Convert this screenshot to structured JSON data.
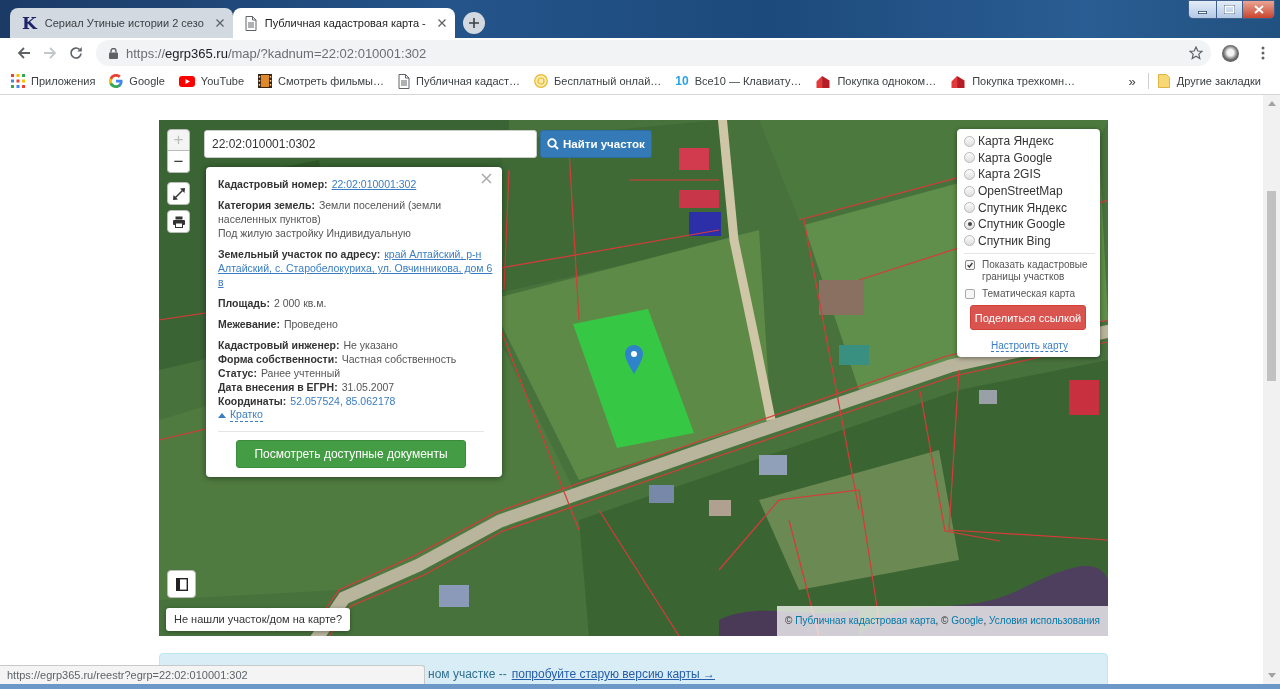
{
  "browser": {
    "tabs": [
      {
        "title": "Сериал Утиные истории 2 сезо",
        "kind": "letter",
        "favicon_text": "K",
        "selected": false
      },
      {
        "title": "Публичная кадастровая карта -",
        "kind": "page",
        "selected": true
      }
    ],
    "navigation": {
      "back_disabled": false,
      "forward_disabled": true
    },
    "url": [
      {
        "text": "https://",
        "emphasis": false
      },
      {
        "text": "egrp365.ru",
        "emphasis": true
      },
      {
        "text": "/map/?kadnum=22:02:010001:302",
        "emphasis": false
      }
    ],
    "bookmarks": [
      {
        "title": "Приложения",
        "kind": "apps"
      },
      {
        "title": "Google",
        "kind": "google"
      },
      {
        "title": "YouTube",
        "kind": "video"
      },
      {
        "title": "Смотреть фильмы…",
        "kind": "film"
      },
      {
        "title": "Публичная кадаст…",
        "kind": "page"
      },
      {
        "title": "Бесплатный онлай…",
        "kind": "ring"
      },
      {
        "title": "Все10 — Клавиату…",
        "kind": "number",
        "icon_text": "10"
      },
      {
        "title": "Покупка одноком…",
        "kind": "house"
      },
      {
        "title": "Покупка трехкомн…",
        "kind": "house"
      }
    ],
    "bookmarks_overflow": "»",
    "other_bookmarks": "Другие закладки"
  },
  "map": {
    "zoom": [
      {
        "label": "+",
        "disabled": true
      },
      {
        "label": "−",
        "disabled": false
      }
    ],
    "search": {
      "value": "22:02:010001:0302",
      "button": "Найти участок"
    },
    "popup": {
      "sections": [
        [
          {
            "label": "Кадастровый номер:",
            "value": "22:02:010001:302",
            "kind": "link"
          }
        ],
        [
          {
            "label": "Категория земель:",
            "value": "Земли поселений (земли населенных пунктов)",
            "kind": "text"
          },
          {
            "value": "Под жилую застройку Индивидуальную",
            "kind": "text"
          }
        ],
        [
          {
            "label": "Земельный участок по адресу:",
            "lines": [
              "край Алтайский, р-н",
              "Алтайский, с. Старобелокуриха, ул. Овчинникова, дом 6",
              "в"
            ],
            "kind": "link"
          }
        ],
        [
          {
            "label": "Площадь:",
            "value": "2 000 кв.м.",
            "kind": "text"
          }
        ],
        [
          {
            "label": "Межевание:",
            "value": "Проведено",
            "kind": "text"
          }
        ],
        [
          {
            "label": "Кадастровый инженер:",
            "value": "Не указано",
            "kind": "text"
          },
          {
            "label": "Форма собственности:",
            "value": "Частная собственность",
            "kind": "text"
          },
          {
            "label": "Статус:",
            "value": "Ранее учтенный",
            "kind": "text"
          },
          {
            "label": "Дата внесения в ЕГРН:",
            "value": "31.05.2007",
            "kind": "text"
          },
          {
            "label": "Координаты:",
            "value": "52.057524, 85.062178",
            "kind": "accent"
          }
        ]
      ],
      "collapse_link": "Кратко",
      "button": "Посмотреть доступные документы"
    },
    "layers": {
      "options": [
        {
          "label": "Карта Яндекс",
          "selected": false
        },
        {
          "label": "Карта Google",
          "selected": false
        },
        {
          "label": "Карта 2GIS",
          "selected": false
        },
        {
          "label": "OpenStreetMap",
          "selected": false
        },
        {
          "label": "Спутник Яндекс",
          "selected": false
        },
        {
          "label": "Спутник Google",
          "selected": true
        },
        {
          "label": "Спутник Bing",
          "selected": false
        }
      ],
      "toggles": [
        {
          "label": "Показать кадастровые границы участков",
          "checked": true
        },
        {
          "label": "Тематическая карта",
          "checked": false
        }
      ],
      "share_button": "Поделиться ссылкой",
      "settings_link": "Настроить карту"
    },
    "help_prompt": "Не нашли участок/дом на карте?",
    "attribution": [
      {
        "text": "© ",
        "kind": "text"
      },
      {
        "text": "Публичная кадастровая карта",
        "kind": "link"
      },
      {
        "text": ", © ",
        "kind": "text"
      },
      {
        "text": "Google",
        "kind": "link"
      },
      {
        "text": ", ",
        "kind": "text"
      },
      {
        "text": "Условия использования",
        "kind": "link"
      }
    ]
  },
  "notice": {
    "text": "ном участке --",
    "link": "попробуйте старую версию карты →"
  },
  "status_url": "https://egrp365.ru/reestr?egrp=22:02:010001:302"
}
